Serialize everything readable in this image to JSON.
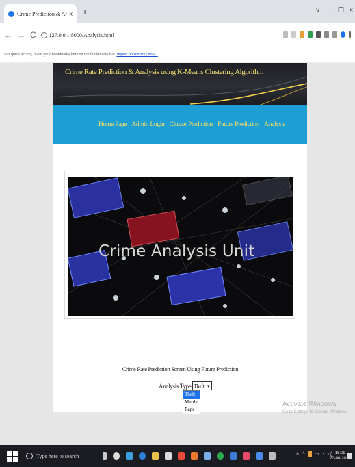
{
  "browser": {
    "tab_title": "Crime Prediction & Analysis",
    "tab_close": "x",
    "new_tab": "+",
    "window_controls": [
      "∨",
      "−",
      "❐",
      "X"
    ],
    "back": "←",
    "forward": "→",
    "reload": "C",
    "url": "127.0.0.1:8000/Analysis.html",
    "bookmarks_text": "For quick access, place your bookmarks here on the bookmarks bar.",
    "bookmarks_link": "Import bookmarks now..."
  },
  "site": {
    "banner_title": "Crime Rate Prediction & Analysis using K-Means Clustering Algorithm",
    "nav": [
      "Home Page",
      "Admin Login",
      "Cluster Prediction",
      "Future Prediction",
      "Analysis"
    ]
  },
  "hero": {
    "overlay_text": "Crime Analysis Unit"
  },
  "form": {
    "heading": "Crime Rate Prediction Screen Using Future Prediction",
    "label": "Analysis Type",
    "selected": "Theft",
    "options": [
      "Theft",
      "Murder",
      "Rape"
    ]
  },
  "watermark": {
    "line1": "Activate Windows",
    "line2": "Go to Settings to activate Windows."
  },
  "taskbar": {
    "search_placeholder": "Type here to search",
    "time": "16:09",
    "date": "20-06-2022"
  },
  "colors": {
    "nav_bg": "#1d9fd3",
    "nav_link": "#ffe066",
    "banner_title": "#f4e070",
    "dropdown_highlight": "#1e73e8"
  }
}
